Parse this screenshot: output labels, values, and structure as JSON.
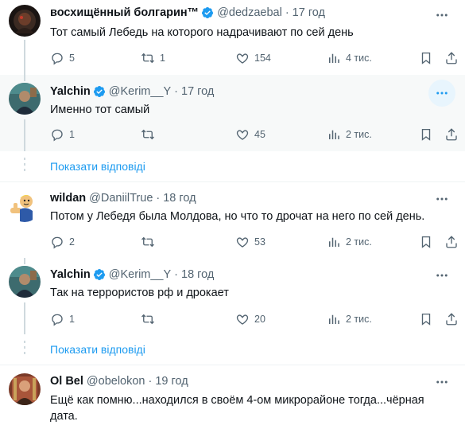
{
  "tweets": [
    {
      "name": "восхищённый болгарин™",
      "verified": true,
      "handle": "@dedzaebal",
      "dot": "·",
      "time": "17 год",
      "text": "Тот самый Лебедь на которого надрачивают по сей день",
      "replies": "5",
      "retweets": "1",
      "likes": "154",
      "views": "4 тис."
    },
    {
      "name": "Yalchin",
      "verified": true,
      "handle": "@Kerim__Y",
      "dot": "·",
      "time": "17 год",
      "text": "Именно тот самый",
      "replies": "1",
      "retweets": "",
      "likes": "45",
      "views": "2 тис."
    },
    {
      "name": "wildan",
      "verified": false,
      "handle": "@DaniilTrue",
      "dot": "·",
      "time": "18 год",
      "text": "Потом у Лебедя была Молдова, но что то дрочат на него по сей день.",
      "replies": "2",
      "retweets": "",
      "likes": "53",
      "views": "2 тис."
    },
    {
      "name": "Yalchin",
      "verified": true,
      "handle": "@Kerim__Y",
      "dot": "·",
      "time": "18 год",
      "text": "Так на террористов рф и дрокает",
      "replies": "1",
      "retweets": "",
      "likes": "20",
      "views": "2 тис."
    },
    {
      "name": "Ol Bel",
      "verified": false,
      "handle": "@obelokon",
      "dot": "·",
      "time": "19 год",
      "text": "Ещё как помню...находился в своём 4-ом микрорайоне тогда...чёрная дата."
    }
  ],
  "show_replies_label": "Показати відповіді",
  "more_icon": "more-horizontal-icon",
  "colors": {
    "accent": "#1d9bf0",
    "muted": "#536471",
    "highlight": "#f7f9f9"
  }
}
